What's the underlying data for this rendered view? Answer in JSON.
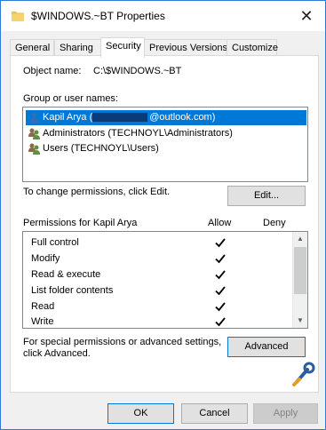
{
  "window": {
    "title": "$WINDOWS.~BT Properties",
    "close_glyph": "✕"
  },
  "tabs": [
    {
      "label": "General"
    },
    {
      "label": "Sharing"
    },
    {
      "label": "Security",
      "active": true
    },
    {
      "label": "Previous Versions"
    },
    {
      "label": "Customize"
    }
  ],
  "security": {
    "object_name_label": "Object name:",
    "object_name_value": "C:\\$WINDOWS.~BT",
    "group_label": "Group or user names:",
    "users": [
      {
        "prefix": "Kapil Arya (",
        "suffix": "@outlook.com)",
        "icon": "user-icon",
        "selected": true
      },
      {
        "text": "Administrators (TECHNOYL\\Administrators)",
        "icon": "group-icon"
      },
      {
        "text": "Users (TECHNOYL\\Users)",
        "icon": "group-icon"
      }
    ],
    "change_text": "To change permissions, click Edit.",
    "edit_label": "Edit...",
    "permissions_header": "Permissions for Kapil Arya",
    "allow_label": "Allow",
    "deny_label": "Deny",
    "permissions": [
      {
        "name": "Full control",
        "allow": true,
        "deny": false
      },
      {
        "name": "Modify",
        "allow": true,
        "deny": false
      },
      {
        "name": "Read & execute",
        "allow": true,
        "deny": false
      },
      {
        "name": "List folder contents",
        "allow": true,
        "deny": false
      },
      {
        "name": "Read",
        "allow": true,
        "deny": false
      },
      {
        "name": "Write",
        "allow": true,
        "deny": false
      }
    ],
    "special_text_1": "For special permissions or advanced settings,",
    "special_text_2": "click Advanced.",
    "advanced_label": "Advanced"
  },
  "footer": {
    "ok_label": "OK",
    "cancel_label": "Cancel",
    "apply_label": "Apply"
  },
  "colors": {
    "selection": "#0078d7",
    "window_border": "#2b7bd4",
    "folder_icon": "#f5d46b"
  }
}
